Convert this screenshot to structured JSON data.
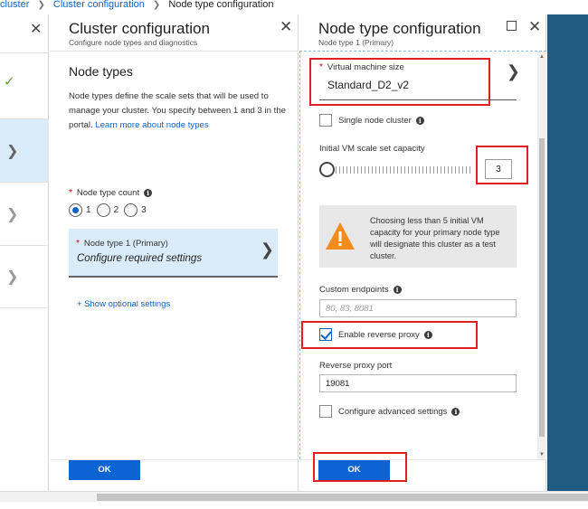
{
  "breadcrumb": {
    "items": [
      "cluster",
      "Cluster configuration",
      "Node type configuration"
    ]
  },
  "cluster_blade": {
    "title": "Cluster configuration",
    "subtitle": "Configure node types and diagnostics",
    "section_heading": "Node types",
    "description": "Node types define the scale sets that will be used to manage your cluster. You specify between 1 and 3 in the portal.",
    "learn_more": "Learn more about node types",
    "node_type_count_label": "Node type count",
    "radio_options": [
      "1",
      "2",
      "3"
    ],
    "selected_count": "1",
    "node_type_card": {
      "title": "Node type 1 (Primary)",
      "subtitle": "Configure required settings"
    },
    "optional_link": "+ Show optional settings",
    "ok_label": "OK"
  },
  "node_blade": {
    "title": "Node type configuration",
    "subtitle": "Node type 1 (Primary)",
    "vm_size_label": "Virtual machine size",
    "vm_size_value": "Standard_D2_v2",
    "single_node_label": "Single node cluster",
    "single_node_checked": false,
    "capacity_label": "Initial VM scale set capacity",
    "capacity_value": "3",
    "warning_text": "Choosing less than 5 initial VM capacity for your primary node type will designate this cluster as a test cluster.",
    "custom_endpoints_label": "Custom endpoints",
    "custom_endpoints_placeholder": "80, 83, 8081",
    "reverse_proxy_label": "Enable reverse proxy",
    "reverse_proxy_checked": true,
    "reverse_proxy_port_label": "Reverse proxy port",
    "reverse_proxy_port_value": "19081",
    "advanced_label": "Configure advanced settings",
    "advanced_checked": false,
    "ok_label": "OK"
  },
  "colors": {
    "accent": "#0c63d4",
    "link": "#0f63c3",
    "highlight": "#e02020",
    "warning": "#f28c1e",
    "side_strip": "#1f5b83",
    "selected_card": "#daecfa"
  }
}
